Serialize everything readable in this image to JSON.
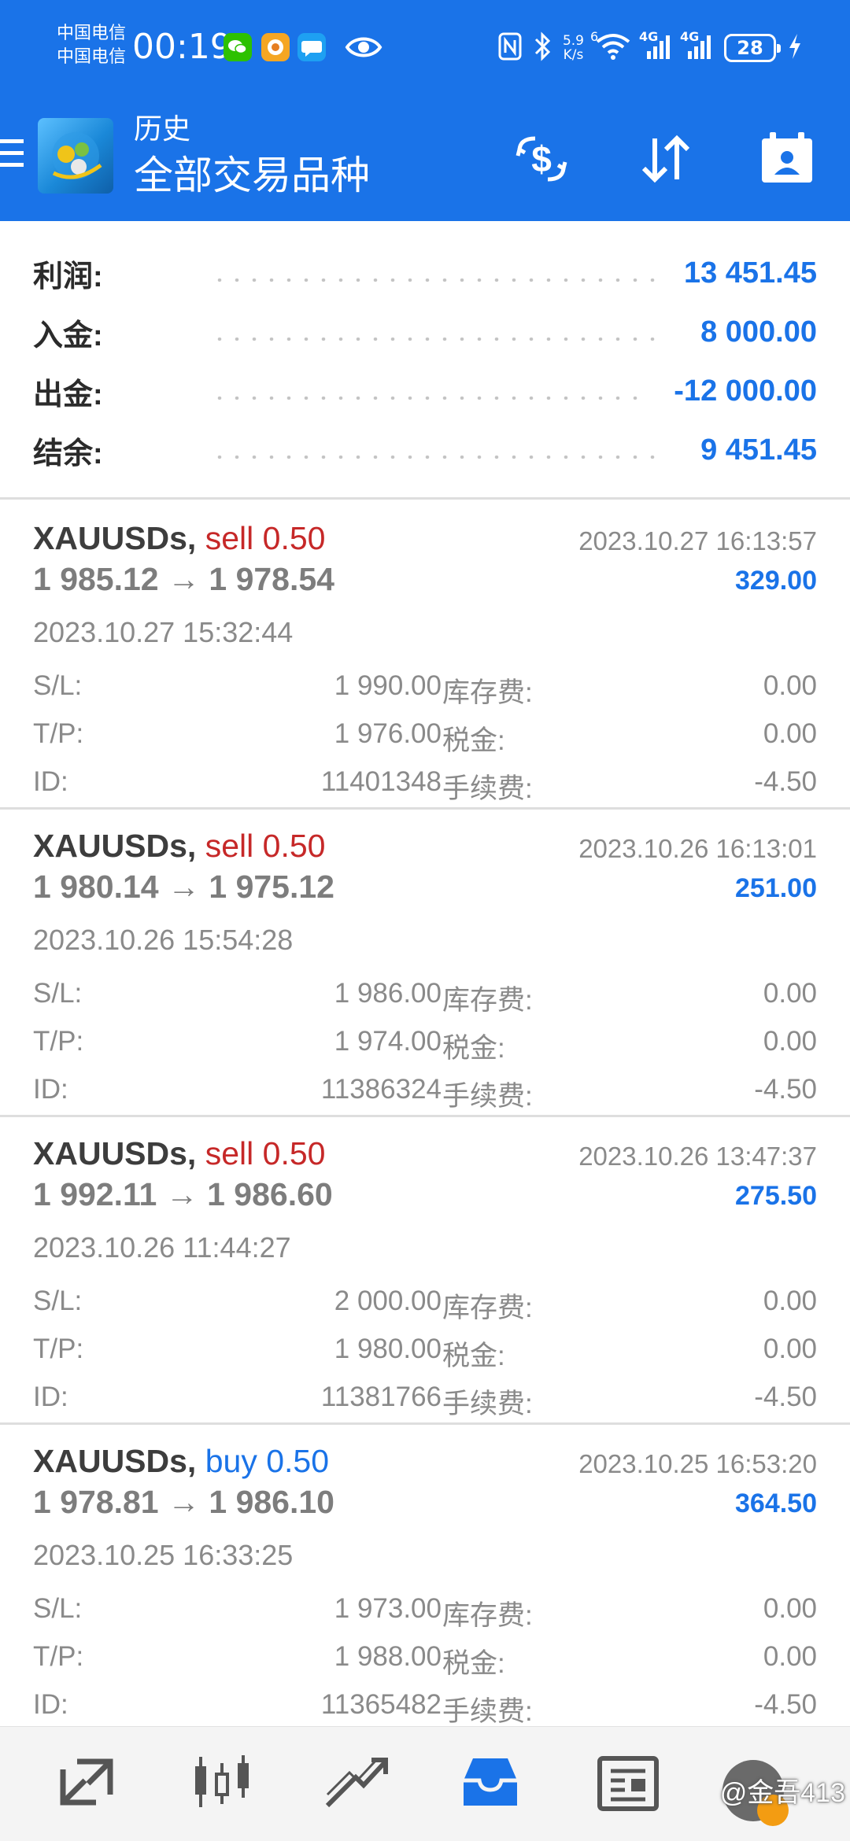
{
  "status_bar": {
    "carrier_1": "中国电信",
    "carrier_2": "中国电信",
    "time": "00:19",
    "net_speed_value": "5.9",
    "net_speed_unit": "K/s",
    "wifi_slot": "6",
    "signal_1": "4G",
    "signal_2": "4G",
    "battery": "28"
  },
  "app_bar": {
    "title": "历史",
    "subtitle": "全部交易品种"
  },
  "summary": [
    {
      "label": "利润:",
      "value": "13 451.45"
    },
    {
      "label": "入金:",
      "value": "8 000.00"
    },
    {
      "label": "出金:",
      "value": "-12 000.00"
    },
    {
      "label": "结余:",
      "value": "9 451.45"
    }
  ],
  "trade_labels": {
    "sl": "S/L:",
    "tp": "T/P:",
    "id": "ID:",
    "swap": "库存费:",
    "tax": "税金:",
    "fee": "手续费:"
  },
  "trades": [
    {
      "symbol": "XAUUSDs,",
      "side": "sell 0.50",
      "close_time": "2023.10.27 16:13:57",
      "prices": "1 985.12 → 1 978.54",
      "profit": "329.00",
      "open_time": "2023.10.27 15:32:44",
      "sl": "1 990.00",
      "tp": "1 976.00",
      "id": "11401348",
      "swap": "0.00",
      "tax": "0.00",
      "fee": "-4.50"
    },
    {
      "symbol": "XAUUSDs,",
      "side": "sell 0.50",
      "close_time": "2023.10.26 16:13:01",
      "prices": "1 980.14 → 1 975.12",
      "profit": "251.00",
      "open_time": "2023.10.26 15:54:28",
      "sl": "1 986.00",
      "tp": "1 974.00",
      "id": "11386324",
      "swap": "0.00",
      "tax": "0.00",
      "fee": "-4.50"
    },
    {
      "symbol": "XAUUSDs,",
      "side": "sell 0.50",
      "close_time": "2023.10.26 13:47:37",
      "prices": "1 992.11 → 1 986.60",
      "profit": "275.50",
      "open_time": "2023.10.26 11:44:27",
      "sl": "2 000.00",
      "tp": "1 980.00",
      "id": "11381766",
      "swap": "0.00",
      "tax": "0.00",
      "fee": "-4.50"
    },
    {
      "symbol": "XAUUSDs,",
      "side": "buy 0.50",
      "close_time": "2023.10.25 16:53:20",
      "prices": "1 978.81 → 1 986.10",
      "profit": "364.50",
      "open_time": "2023.10.25 16:33:25",
      "sl": "1 973.00",
      "tp": "1 988.00",
      "id": "11365482",
      "swap": "0.00",
      "tax": "0.00",
      "fee": "-4.50"
    }
  ],
  "bottom_nav": [
    {
      "icon": "quotes-icon"
    },
    {
      "icon": "chart-icon"
    },
    {
      "icon": "trade-icon"
    },
    {
      "icon": "history-icon",
      "active": true
    },
    {
      "icon": "news-icon"
    }
  ],
  "watermark": "@金吾413",
  "colors": {
    "accent": "#1a73e8",
    "sell": "#c62828",
    "buy": "#1a73e8",
    "muted": "#8a8a8a"
  }
}
